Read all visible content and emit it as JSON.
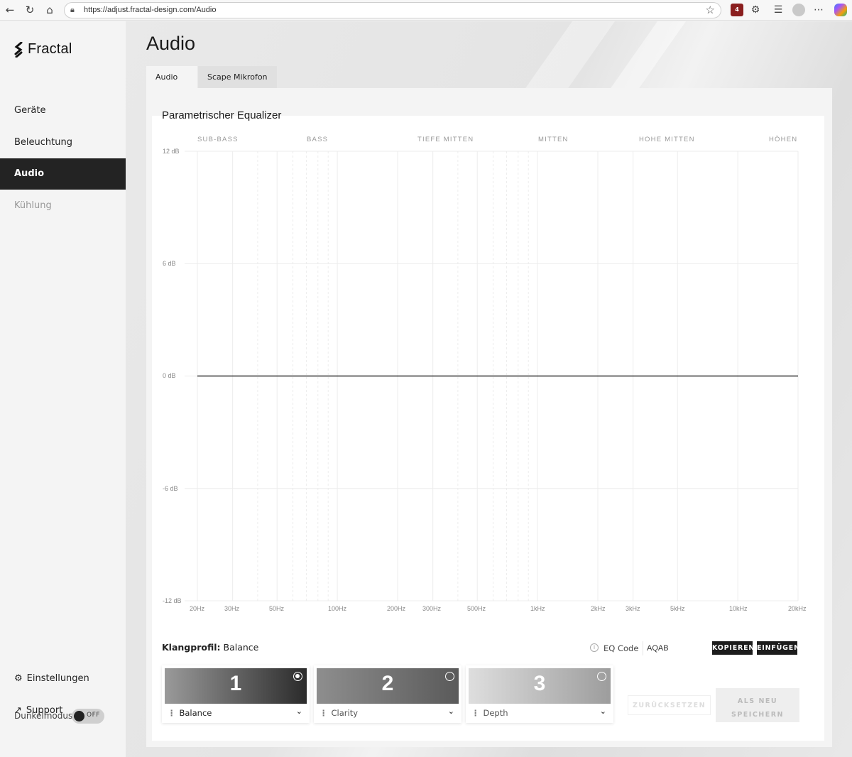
{
  "browser": {
    "url": "https://adjust.fractal-design.com/Audio",
    "ext_badge": "4"
  },
  "sidebar": {
    "logo": "Fractal",
    "items": [
      {
        "label": "Geräte"
      },
      {
        "label": "Beleuchtung"
      },
      {
        "label": "Audio"
      },
      {
        "label": "Kühlung"
      }
    ],
    "settings": "Einstellungen",
    "support": "Support",
    "dark_mode_label": "Dunkelmodus",
    "dark_mode_state": "OFF"
  },
  "main": {
    "title": "Audio",
    "tabs": [
      {
        "label": "Audio"
      },
      {
        "label": "Scape Mikrofon"
      }
    ]
  },
  "equalizer": {
    "title": "Parametrischer Equalizer",
    "bands": [
      "SUB-BASS",
      "BASS",
      "TIEFE MITTEN",
      "MITTEN",
      "HOHE MITTEN",
      "HÖHEN"
    ],
    "y_ticks": [
      "12 dB",
      "6 dB",
      "0 dB",
      "-6 dB",
      "-12 dB"
    ],
    "x_ticks": [
      "20Hz",
      "30Hz",
      "50Hz",
      "100Hz",
      "200Hz",
      "300Hz",
      "500Hz",
      "1kHz",
      "2kHz",
      "3kHz",
      "5kHz",
      "10kHz",
      "20kHz"
    ],
    "gain_db": 0
  },
  "profile": {
    "label": "Klangprofil:",
    "value": "Balance",
    "eq_code_label": "EQ Code",
    "eq_code_value": "AQAB",
    "copy_button": "KOPIEREN",
    "paste_button": "EINFÜGEN",
    "cards": [
      {
        "num": "1",
        "name": "Balance",
        "selected": true
      },
      {
        "num": "2",
        "name": "Clarity",
        "selected": false
      },
      {
        "num": "3",
        "name": "Depth",
        "selected": false
      }
    ],
    "reset_button": "ZURÜCKSETZEN",
    "save_new_button_line1": "ALS NEU",
    "save_new_button_line2": "SPEICHERN"
  }
}
